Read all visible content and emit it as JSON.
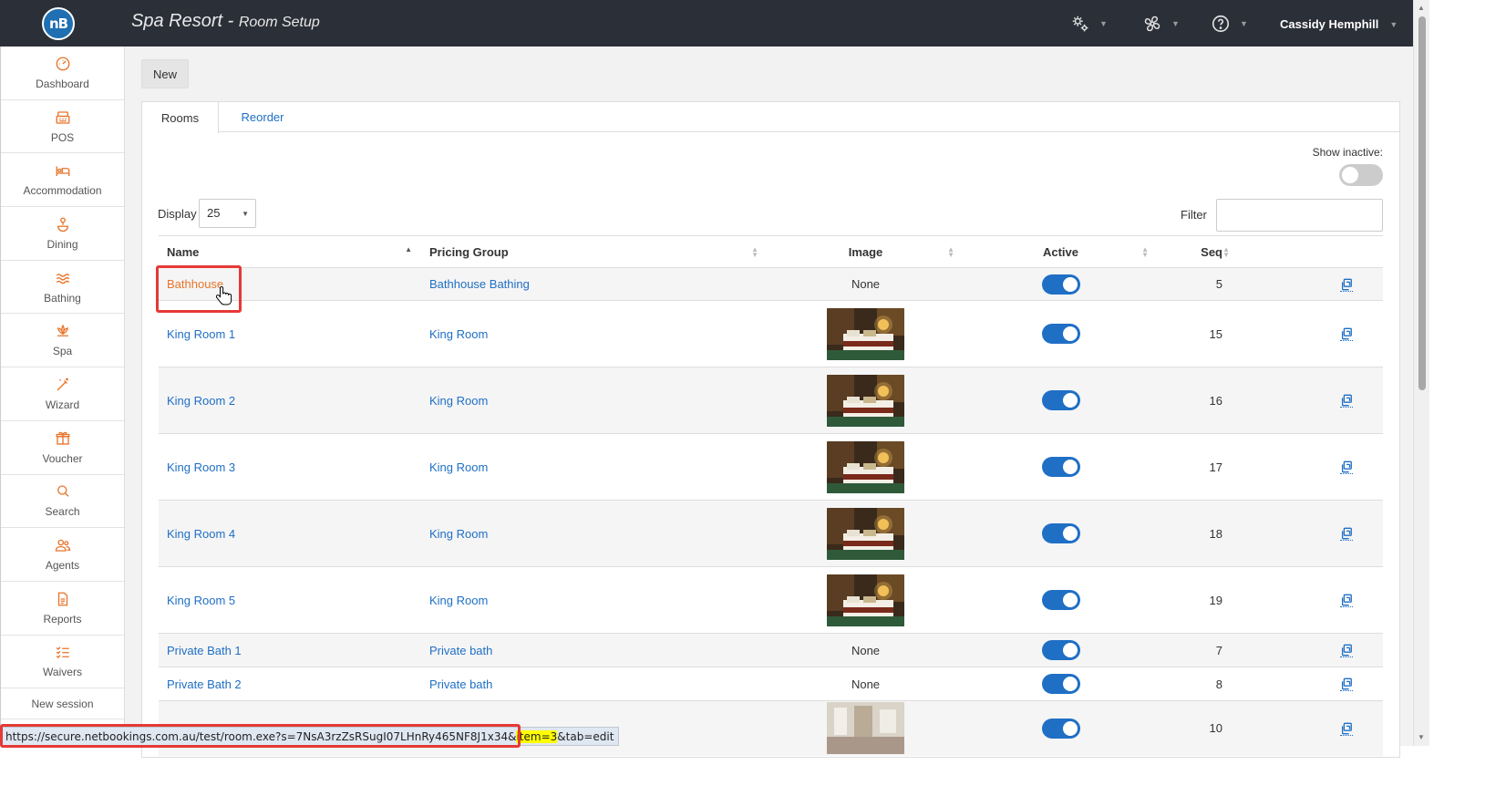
{
  "app": {
    "title": "Spa Resort",
    "subtitle": "Room Setup",
    "logo_text": "nB",
    "user_name": "Cassidy Hemphill"
  },
  "sidebar": {
    "items": [
      {
        "label": "Dashboard",
        "icon": "dashboard-icon"
      },
      {
        "label": "POS",
        "icon": "pos-icon"
      },
      {
        "label": "Accommodation",
        "icon": "bed-icon"
      },
      {
        "label": "Dining",
        "icon": "dining-icon"
      },
      {
        "label": "Bathing",
        "icon": "waves-icon"
      },
      {
        "label": "Spa",
        "icon": "lotus-icon"
      },
      {
        "label": "Wizard",
        "icon": "wand-icon"
      },
      {
        "label": "Voucher",
        "icon": "gift-icon"
      },
      {
        "label": "Search",
        "icon": "search-icon"
      },
      {
        "label": "Agents",
        "icon": "people-icon"
      },
      {
        "label": "Reports",
        "icon": "document-icon"
      },
      {
        "label": "Waivers",
        "icon": "checklist-icon"
      }
    ],
    "new_session": "New session"
  },
  "toolbar": {
    "new_label": "New"
  },
  "tabs": [
    {
      "label": "Rooms",
      "active": true
    },
    {
      "label": "Reorder",
      "active": false
    }
  ],
  "controls": {
    "show_inactive_label": "Show inactive:",
    "show_inactive": false,
    "display_label": "Display",
    "display_value": "25",
    "filter_label": "Filter",
    "filter_value": ""
  },
  "table": {
    "columns": [
      "Name",
      "Pricing Group",
      "Image",
      "Active",
      "Seq"
    ],
    "sorted_column": "Name",
    "rows": [
      {
        "name": "Bathhouse",
        "group": "Bathhouse Bathing",
        "image": "None",
        "active": true,
        "seq": "5",
        "hovered": true
      },
      {
        "name": "King Room 1",
        "group": "King Room",
        "image": "bedroom-photo",
        "active": true,
        "seq": "15"
      },
      {
        "name": "King Room 2",
        "group": "King Room",
        "image": "bedroom-photo",
        "active": true,
        "seq": "16"
      },
      {
        "name": "King Room 3",
        "group": "King Room",
        "image": "bedroom-photo",
        "active": true,
        "seq": "17"
      },
      {
        "name": "King Room 4",
        "group": "King Room",
        "image": "bedroom-photo",
        "active": true,
        "seq": "18"
      },
      {
        "name": "King Room 5",
        "group": "King Room",
        "image": "bedroom-photo",
        "active": true,
        "seq": "19"
      },
      {
        "name": "Private Bath 1",
        "group": "Private bath",
        "image": "None",
        "active": true,
        "seq": "7"
      },
      {
        "name": "Private Bath 2",
        "group": "Private bath",
        "image": "None",
        "active": true,
        "seq": "8"
      },
      {
        "name": "",
        "group": "",
        "image": "room-photo",
        "active": true,
        "seq": "10"
      }
    ]
  },
  "status_bar": {
    "url_prefix": "https://secure.netbookings.com.au/test/room.exe?s=7NsA3rzZsRSugI07LHnRy465NF8J1x34&",
    "url_highlight": "item=3",
    "url_suffix": "&tab=edit"
  },
  "colors": {
    "topbar": "#2b2f38",
    "accent": "#1f6fc5",
    "sidebar_icon": "#e8742a",
    "highlight": "#e53935"
  }
}
